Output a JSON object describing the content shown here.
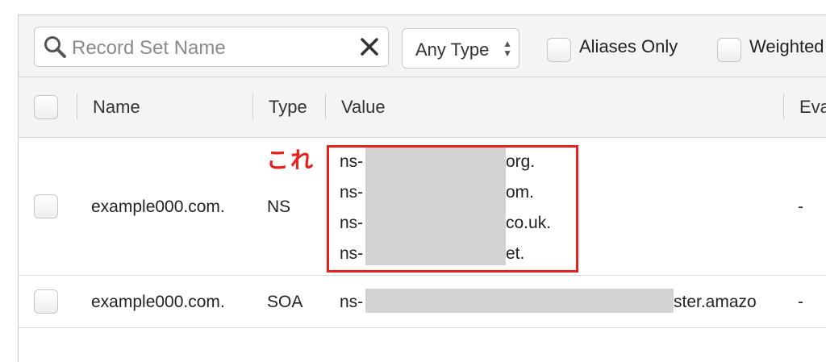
{
  "toolbar": {
    "search_placeholder": "Record Set Name",
    "type_filter": "Any Type",
    "aliases_only_label": "Aliases Only",
    "weighted_label": "Weighted"
  },
  "table": {
    "columns": [
      "Name",
      "Type",
      "Value",
      "Eva"
    ],
    "rows": [
      {
        "name": "example000.com.",
        "type": "NS",
        "values": [
          "ns-",
          "ns-",
          "ns-",
          "ns-"
        ],
        "value_suffixes": [
          "org.",
          "om.",
          "co.uk.",
          "et."
        ],
        "evaluate": "-"
      },
      {
        "name": "example000.com.",
        "type": "SOA",
        "value_prefix": "ns-",
        "value_suffix": "ster.amazo",
        "evaluate": "-"
      }
    ]
  },
  "annotation": {
    "text": "これ",
    "color": "#e8201c"
  }
}
